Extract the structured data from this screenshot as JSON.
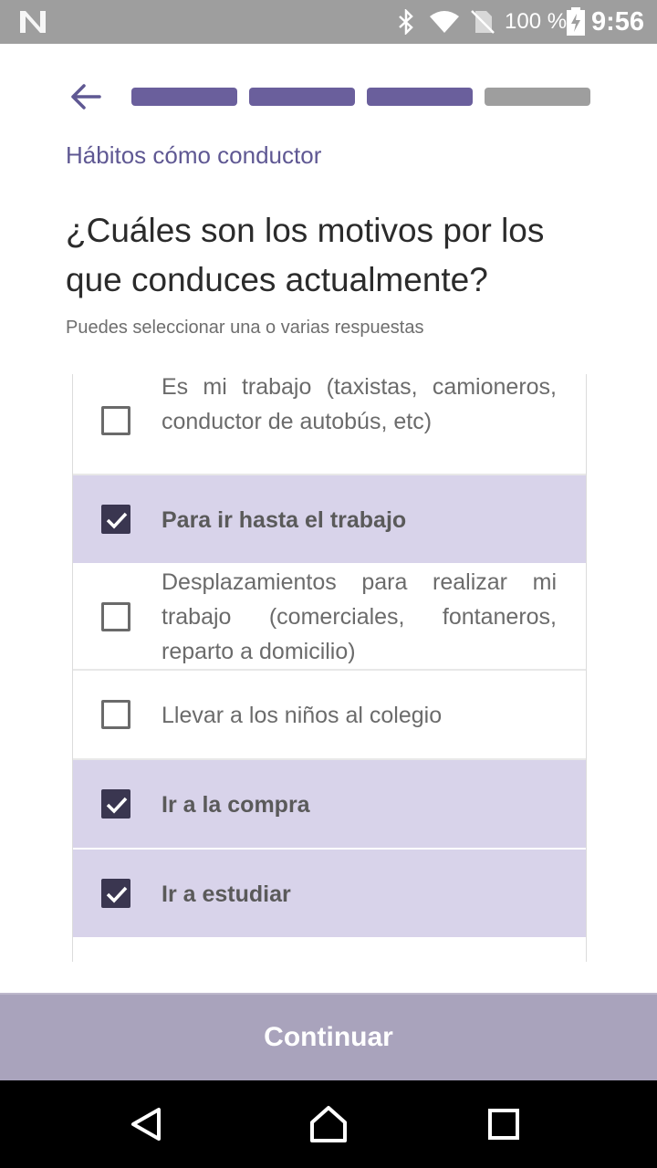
{
  "status_bar": {
    "battery_text": "100 %",
    "time": "9:56",
    "icons": [
      "n-logo-icon",
      "bluetooth-icon",
      "wifi-icon",
      "no-sim-icon",
      "battery-icon"
    ]
  },
  "progress": {
    "steps_total": 4,
    "steps_completed": 3,
    "active_color": "#6a5f9c",
    "inactive_color": "#9e9e9e"
  },
  "section_label": "Hábitos cómo conductor",
  "question": "¿Cuáles son los motivos por los que conduces actualmente?",
  "hint": "Puedes seleccionar una o varias respuestas",
  "options": [
    {
      "label": "Es mi trabajo (taxistas, camioneros, conductor de autobús, etc)",
      "selected": false
    },
    {
      "label": "Para ir hasta el trabajo",
      "selected": true
    },
    {
      "label": "Desplazamientos para realizar mi trabajo (comerciales, fontaneros, reparto a domicilio)",
      "selected": false
    },
    {
      "label": "Llevar a los niños al colegio",
      "selected": false
    },
    {
      "label": "Ir a la compra",
      "selected": true
    },
    {
      "label": "Ir a estudiar",
      "selected": true
    }
  ],
  "continue_label": "Continuar",
  "colors": {
    "accent": "#5f5893",
    "selected_bg": "#d8d3ea",
    "button_bg": "#a9a3bc"
  }
}
